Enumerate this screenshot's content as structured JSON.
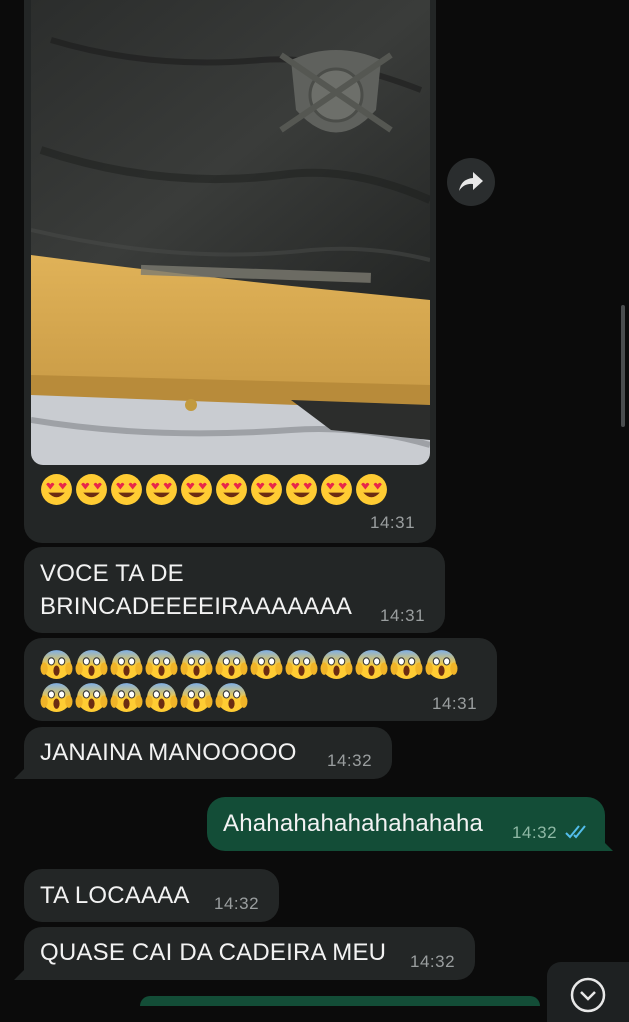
{
  "messages": [
    {
      "id": "photo-msg",
      "direction": "in",
      "emoji_name": "heart-eyes-face",
      "emoji_count": 10,
      "time": "14:31"
    },
    {
      "id": "msg-2",
      "direction": "in",
      "text": "VOCE TA DE\nBRINCADEEEEIRAAAAAAA",
      "time": "14:31"
    },
    {
      "id": "msg-3",
      "direction": "in",
      "emoji_name": "face-screaming-in-fear",
      "emoji_count": 18,
      "time": "14:31"
    },
    {
      "id": "msg-4",
      "direction": "in",
      "text": "JANAINA MANOOOOO",
      "time": "14:32"
    },
    {
      "id": "msg-5",
      "direction": "out",
      "text": "Ahahahahahahahahaha",
      "time": "14:32",
      "status": "read"
    },
    {
      "id": "msg-6",
      "direction": "in",
      "text": "TA LOCAAAA",
      "time": "14:32"
    },
    {
      "id": "msg-7",
      "direction": "in",
      "text": "QUASE CAI DA CADEIRA MEU",
      "time": "14:32"
    }
  ],
  "icons": {
    "forward": "forward-arrow-icon",
    "scroll_down": "chevron-down-circle-icon",
    "read_receipt": "double-check-icon"
  },
  "colors": {
    "background": "#0b0b0b",
    "incoming_bubble": "#232626",
    "outgoing_bubble": "#134d37",
    "timestamp": "#9a9e9f",
    "read_receipt": "#53bdeb"
  }
}
